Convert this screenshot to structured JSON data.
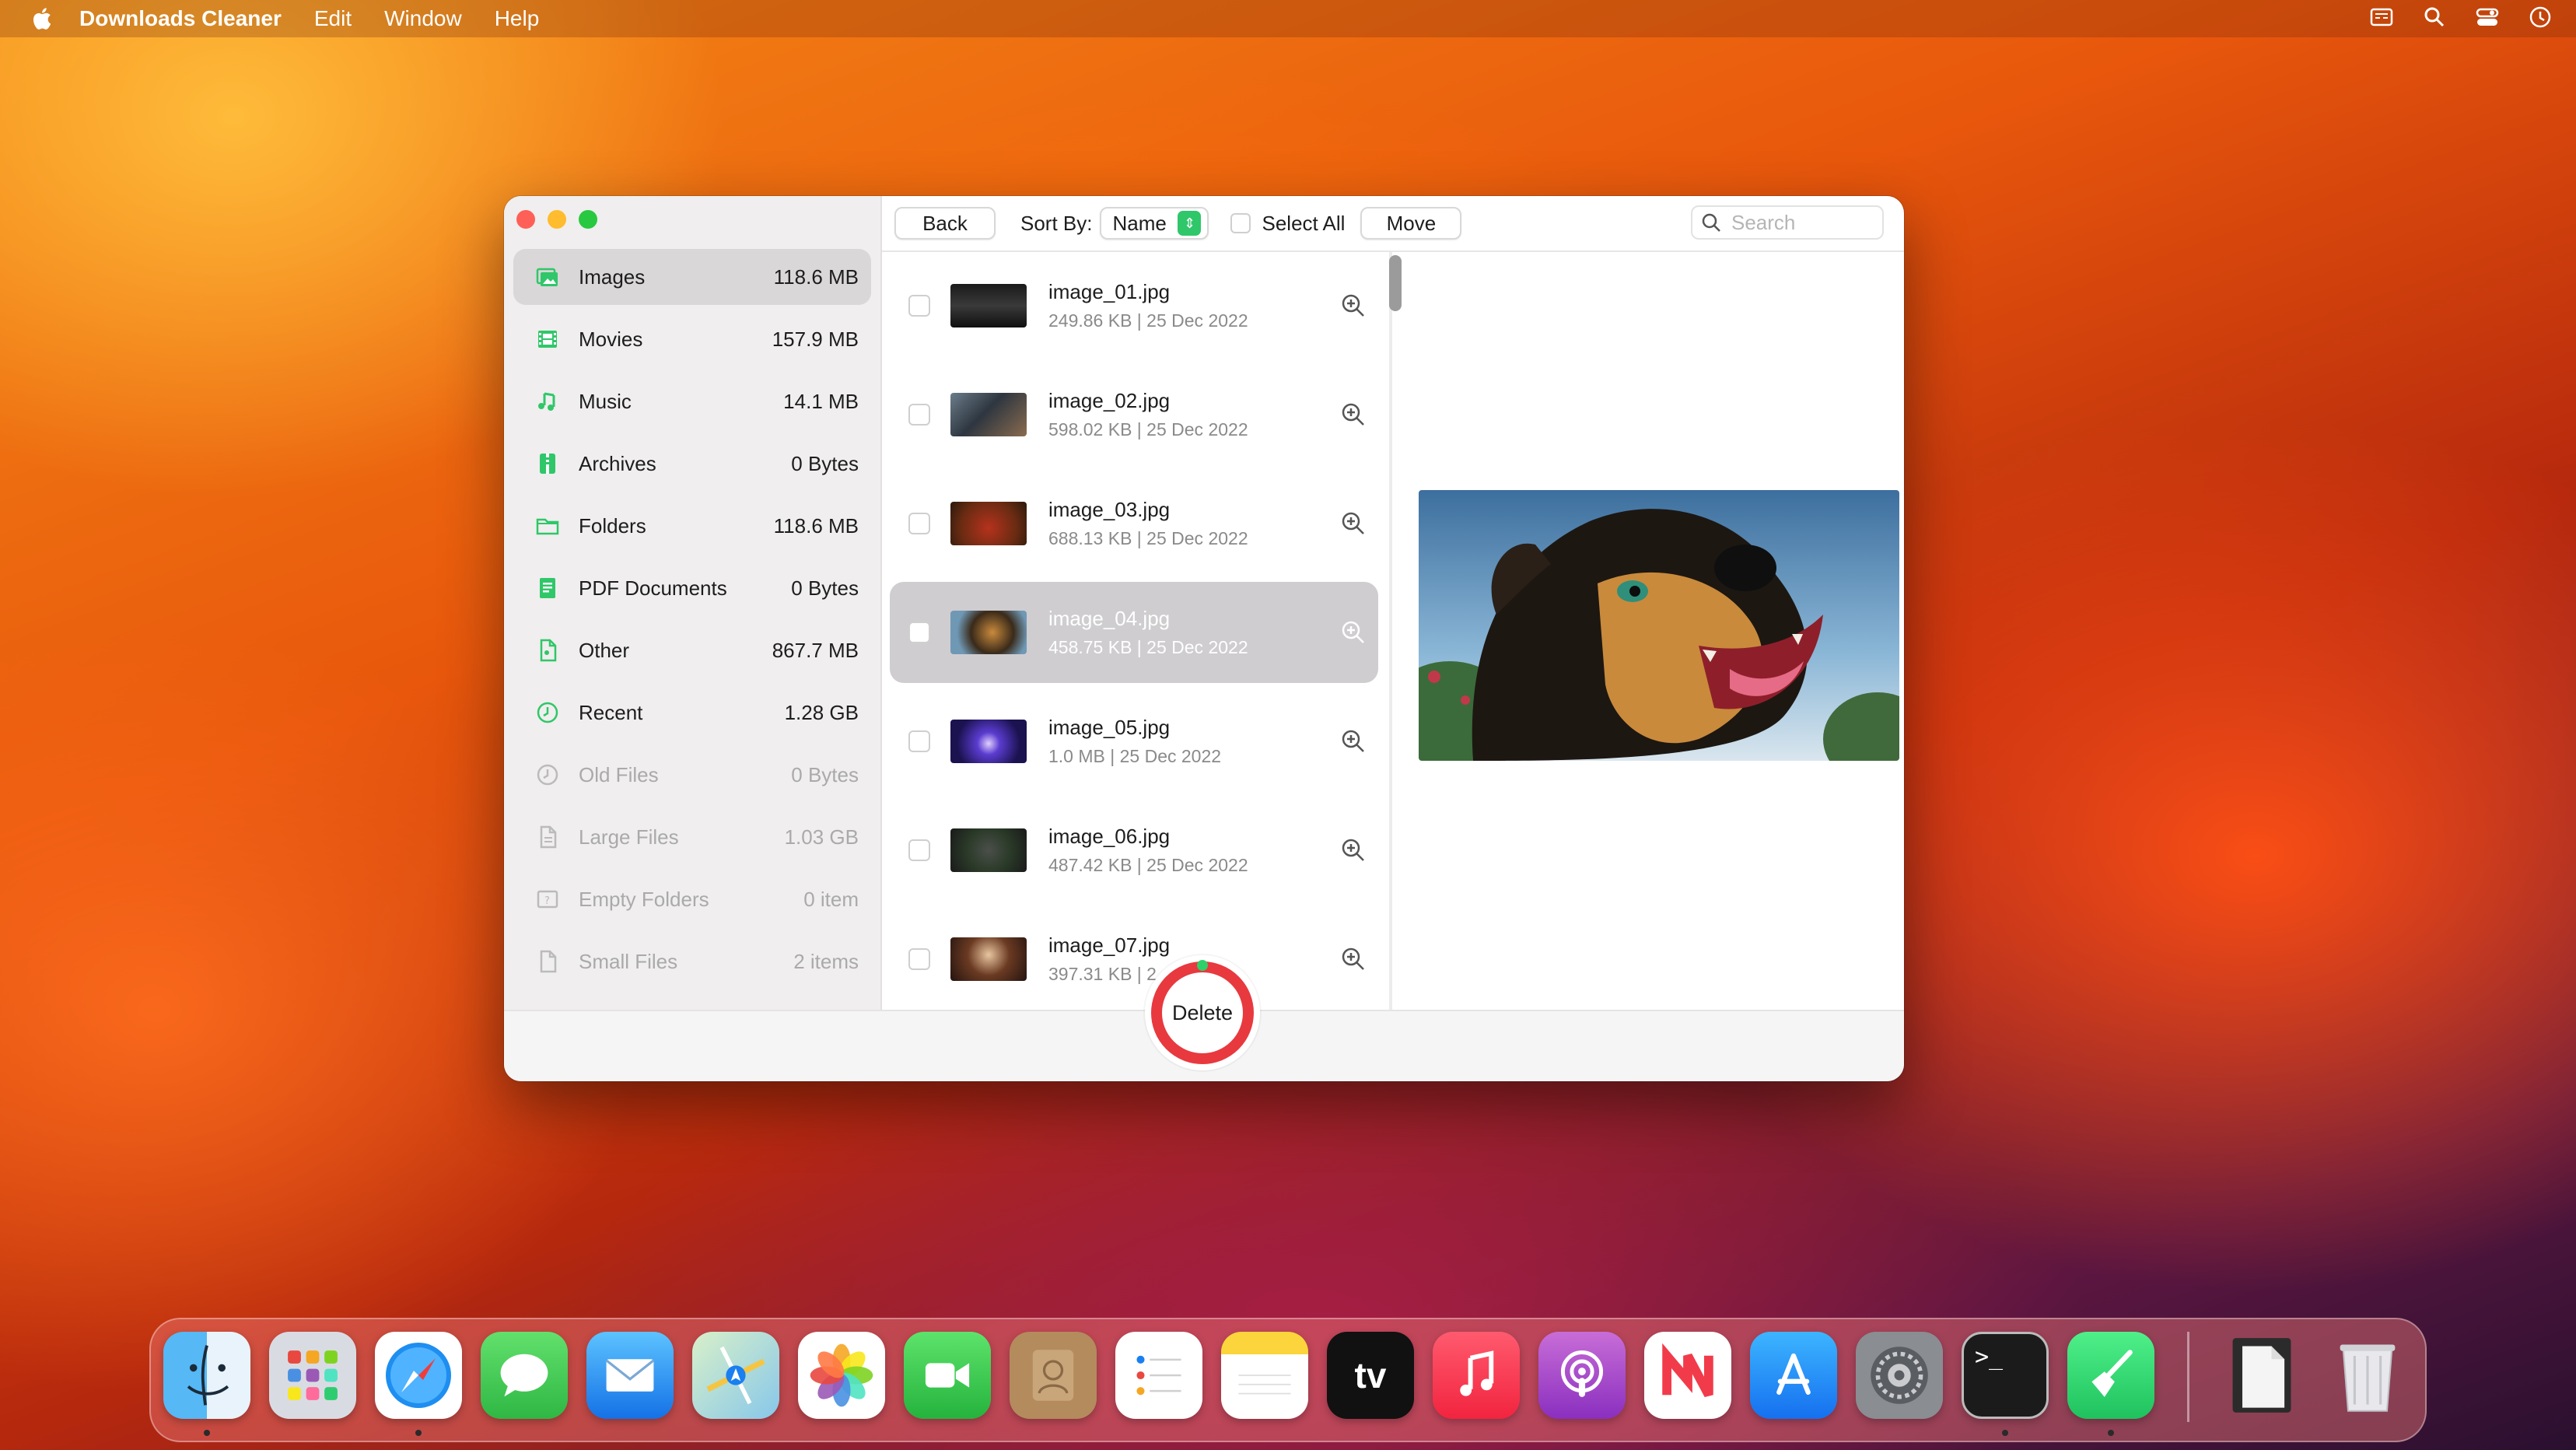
{
  "menubar": {
    "app_name": "Downloads Cleaner",
    "items": [
      "Edit",
      "Window",
      "Help"
    ]
  },
  "sidebar": {
    "items": [
      {
        "label": "Images",
        "size": "118.6 MB",
        "icon": "image-icon"
      },
      {
        "label": "Movies",
        "size": "157.9 MB",
        "icon": "film-icon"
      },
      {
        "label": "Music",
        "size": "14.1 MB",
        "icon": "music-note-icon"
      },
      {
        "label": "Archives",
        "size": "0 Bytes",
        "icon": "archive-icon"
      },
      {
        "label": "Folders",
        "size": "118.6 MB",
        "icon": "folder-icon"
      },
      {
        "label": "PDF Documents",
        "size": "0 Bytes",
        "icon": "pdf-icon"
      },
      {
        "label": "Other",
        "size": "867.7 MB",
        "icon": "document-icon"
      },
      {
        "label": "Recent",
        "size": "1.28 GB",
        "icon": "clock-icon"
      },
      {
        "label": "Old Files",
        "size": "0 Bytes",
        "icon": "clock-icon"
      },
      {
        "label": "Large Files",
        "size": "1.03 GB",
        "icon": "document-icon"
      },
      {
        "label": "Empty Folders",
        "size": "0 item",
        "icon": "question-folder-icon"
      },
      {
        "label": "Small Files",
        "size": "2 items",
        "icon": "document-icon"
      }
    ],
    "selected_index": 0
  },
  "toolbar": {
    "back_label": "Back",
    "sort_label": "Sort By:",
    "sort_value": "Name",
    "select_all_label": "Select All",
    "move_label": "Move",
    "search_placeholder": "Search"
  },
  "files": [
    {
      "name": "image_01.jpg",
      "meta": "249.86 KB | 25 Dec 2022"
    },
    {
      "name": "image_02.jpg",
      "meta": "598.02 KB | 25 Dec 2022"
    },
    {
      "name": "image_03.jpg",
      "meta": "688.13 KB | 25 Dec 2022"
    },
    {
      "name": "image_04.jpg",
      "meta": "458.75 KB | 25 Dec 2022"
    },
    {
      "name": "image_05.jpg",
      "meta": "1.0 MB | 25 Dec 2022"
    },
    {
      "name": "image_06.jpg",
      "meta": "487.42 KB | 25 Dec 2022"
    },
    {
      "name": "image_07.jpg",
      "meta": "397.31 KB | 2"
    }
  ],
  "selected_file_index": 3,
  "delete_label": "Delete",
  "colors": {
    "accent_green": "#2fc769",
    "delete_red": "#e8393f",
    "selection_gray": "#cfcdd0"
  },
  "dock": {
    "apps": [
      "Finder",
      "Launchpad",
      "Safari",
      "Messages",
      "Mail",
      "Maps",
      "Photos",
      "FaceTime",
      "Contacts",
      "Reminders",
      "Notes",
      "Apple TV",
      "Music",
      "Podcasts",
      "News",
      "App Store",
      "System Settings",
      "Terminal",
      "Downloads Cleaner",
      "Document",
      "Trash"
    ],
    "tv_label": "tv"
  }
}
